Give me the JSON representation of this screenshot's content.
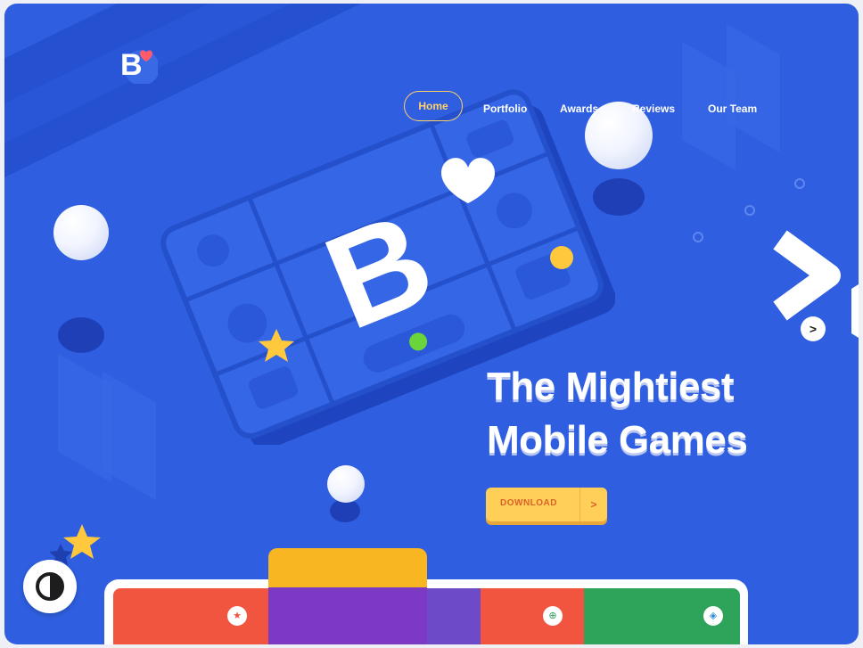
{
  "brand": {
    "logo_letter": "B"
  },
  "nav": {
    "items": [
      {
        "label": "Home"
      },
      {
        "label": "Portfolio"
      },
      {
        "label": "Awards"
      },
      {
        "label": "Reviews"
      },
      {
        "label": "Our Team"
      }
    ],
    "active": "Home"
  },
  "hero": {
    "headline_line1": "The Mightiest",
    "headline_line2": "Mobile Games",
    "cta_label": "DOWNLOAD",
    "cta_arrow": ">",
    "next_arrow": ">"
  },
  "colors": {
    "background": "#2f5fe0",
    "accent": "#ffd166",
    "cta": "#ffcf57",
    "heart": "#ff5b6b"
  },
  "icons": [
    "heart-icon",
    "chevron-right-icon",
    "theme-toggle-icon",
    "star-icon",
    "target-icon",
    "shield-icon"
  ]
}
